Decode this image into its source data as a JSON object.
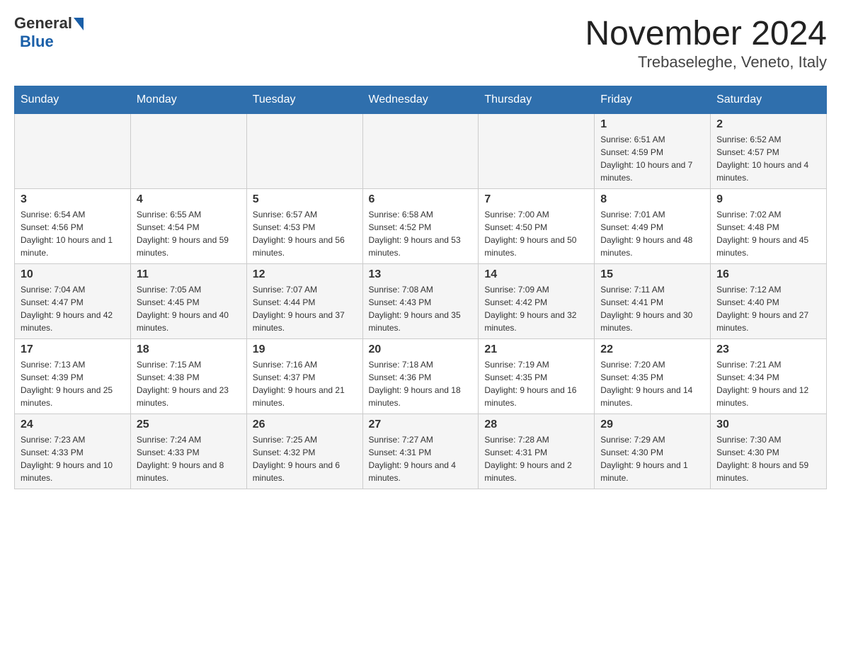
{
  "header": {
    "logo_general": "General",
    "logo_blue": "Blue",
    "month_title": "November 2024",
    "location": "Trebaseleghe, Veneto, Italy"
  },
  "weekdays": [
    "Sunday",
    "Monday",
    "Tuesday",
    "Wednesday",
    "Thursday",
    "Friday",
    "Saturday"
  ],
  "weeks": [
    {
      "days": [
        {
          "number": "",
          "info": ""
        },
        {
          "number": "",
          "info": ""
        },
        {
          "number": "",
          "info": ""
        },
        {
          "number": "",
          "info": ""
        },
        {
          "number": "",
          "info": ""
        },
        {
          "number": "1",
          "info": "Sunrise: 6:51 AM\nSunset: 4:59 PM\nDaylight: 10 hours and 7 minutes."
        },
        {
          "number": "2",
          "info": "Sunrise: 6:52 AM\nSunset: 4:57 PM\nDaylight: 10 hours and 4 minutes."
        }
      ]
    },
    {
      "days": [
        {
          "number": "3",
          "info": "Sunrise: 6:54 AM\nSunset: 4:56 PM\nDaylight: 10 hours and 1 minute."
        },
        {
          "number": "4",
          "info": "Sunrise: 6:55 AM\nSunset: 4:54 PM\nDaylight: 9 hours and 59 minutes."
        },
        {
          "number": "5",
          "info": "Sunrise: 6:57 AM\nSunset: 4:53 PM\nDaylight: 9 hours and 56 minutes."
        },
        {
          "number": "6",
          "info": "Sunrise: 6:58 AM\nSunset: 4:52 PM\nDaylight: 9 hours and 53 minutes."
        },
        {
          "number": "7",
          "info": "Sunrise: 7:00 AM\nSunset: 4:50 PM\nDaylight: 9 hours and 50 minutes."
        },
        {
          "number": "8",
          "info": "Sunrise: 7:01 AM\nSunset: 4:49 PM\nDaylight: 9 hours and 48 minutes."
        },
        {
          "number": "9",
          "info": "Sunrise: 7:02 AM\nSunset: 4:48 PM\nDaylight: 9 hours and 45 minutes."
        }
      ]
    },
    {
      "days": [
        {
          "number": "10",
          "info": "Sunrise: 7:04 AM\nSunset: 4:47 PM\nDaylight: 9 hours and 42 minutes."
        },
        {
          "number": "11",
          "info": "Sunrise: 7:05 AM\nSunset: 4:45 PM\nDaylight: 9 hours and 40 minutes."
        },
        {
          "number": "12",
          "info": "Sunrise: 7:07 AM\nSunset: 4:44 PM\nDaylight: 9 hours and 37 minutes."
        },
        {
          "number": "13",
          "info": "Sunrise: 7:08 AM\nSunset: 4:43 PM\nDaylight: 9 hours and 35 minutes."
        },
        {
          "number": "14",
          "info": "Sunrise: 7:09 AM\nSunset: 4:42 PM\nDaylight: 9 hours and 32 minutes."
        },
        {
          "number": "15",
          "info": "Sunrise: 7:11 AM\nSunset: 4:41 PM\nDaylight: 9 hours and 30 minutes."
        },
        {
          "number": "16",
          "info": "Sunrise: 7:12 AM\nSunset: 4:40 PM\nDaylight: 9 hours and 27 minutes."
        }
      ]
    },
    {
      "days": [
        {
          "number": "17",
          "info": "Sunrise: 7:13 AM\nSunset: 4:39 PM\nDaylight: 9 hours and 25 minutes."
        },
        {
          "number": "18",
          "info": "Sunrise: 7:15 AM\nSunset: 4:38 PM\nDaylight: 9 hours and 23 minutes."
        },
        {
          "number": "19",
          "info": "Sunrise: 7:16 AM\nSunset: 4:37 PM\nDaylight: 9 hours and 21 minutes."
        },
        {
          "number": "20",
          "info": "Sunrise: 7:18 AM\nSunset: 4:36 PM\nDaylight: 9 hours and 18 minutes."
        },
        {
          "number": "21",
          "info": "Sunrise: 7:19 AM\nSunset: 4:35 PM\nDaylight: 9 hours and 16 minutes."
        },
        {
          "number": "22",
          "info": "Sunrise: 7:20 AM\nSunset: 4:35 PM\nDaylight: 9 hours and 14 minutes."
        },
        {
          "number": "23",
          "info": "Sunrise: 7:21 AM\nSunset: 4:34 PM\nDaylight: 9 hours and 12 minutes."
        }
      ]
    },
    {
      "days": [
        {
          "number": "24",
          "info": "Sunrise: 7:23 AM\nSunset: 4:33 PM\nDaylight: 9 hours and 10 minutes."
        },
        {
          "number": "25",
          "info": "Sunrise: 7:24 AM\nSunset: 4:33 PM\nDaylight: 9 hours and 8 minutes."
        },
        {
          "number": "26",
          "info": "Sunrise: 7:25 AM\nSunset: 4:32 PM\nDaylight: 9 hours and 6 minutes."
        },
        {
          "number": "27",
          "info": "Sunrise: 7:27 AM\nSunset: 4:31 PM\nDaylight: 9 hours and 4 minutes."
        },
        {
          "number": "28",
          "info": "Sunrise: 7:28 AM\nSunset: 4:31 PM\nDaylight: 9 hours and 2 minutes."
        },
        {
          "number": "29",
          "info": "Sunrise: 7:29 AM\nSunset: 4:30 PM\nDaylight: 9 hours and 1 minute."
        },
        {
          "number": "30",
          "info": "Sunrise: 7:30 AM\nSunset: 4:30 PM\nDaylight: 8 hours and 59 minutes."
        }
      ]
    }
  ]
}
